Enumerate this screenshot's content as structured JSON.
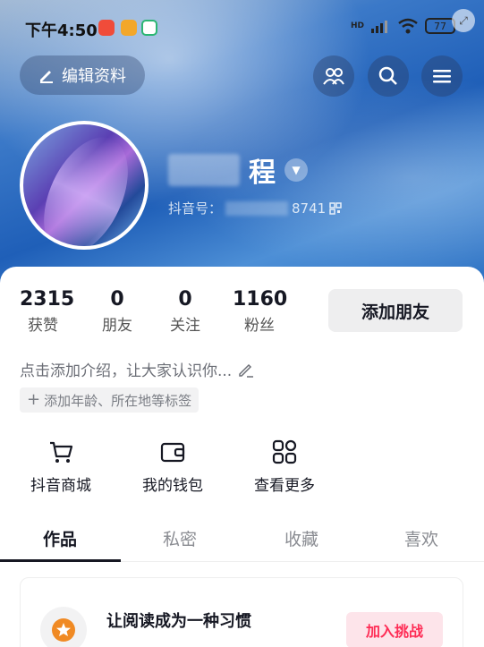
{
  "status_bar": {
    "time": "下午4:50",
    "network": "HD",
    "battery": "77"
  },
  "header": {
    "edit_profile": "编辑资料"
  },
  "profile": {
    "nickname_suffix": "程",
    "douyin_id_label": "抖音号：",
    "douyin_id_tail": "8741"
  },
  "stats": [
    {
      "value": "2315",
      "label": "获赞"
    },
    {
      "value": "0",
      "label": "朋友"
    },
    {
      "value": "0",
      "label": "关注"
    },
    {
      "value": "1160",
      "label": "粉丝"
    }
  ],
  "add_friend_label": "添加朋友",
  "intro_text": "点击添加介绍，让大家认识你...",
  "tag_text": "添加年龄、所在地等标签",
  "shortcuts": [
    {
      "label": "抖音商城",
      "icon": "cart-icon"
    },
    {
      "label": "我的钱包",
      "icon": "wallet-icon"
    },
    {
      "label": "查看更多",
      "icon": "grid-icon"
    }
  ],
  "tabs": [
    {
      "label": "作品",
      "active": true
    },
    {
      "label": "私密",
      "active": false
    },
    {
      "label": "收藏",
      "active": false
    },
    {
      "label": "喜欢",
      "active": false
    }
  ],
  "promo": {
    "title": "让阅读成为一种习惯",
    "button": "加入挑战"
  },
  "colors": {
    "accent": "#fe2c55",
    "text": "#161823",
    "hero": "#2a6fc2"
  }
}
